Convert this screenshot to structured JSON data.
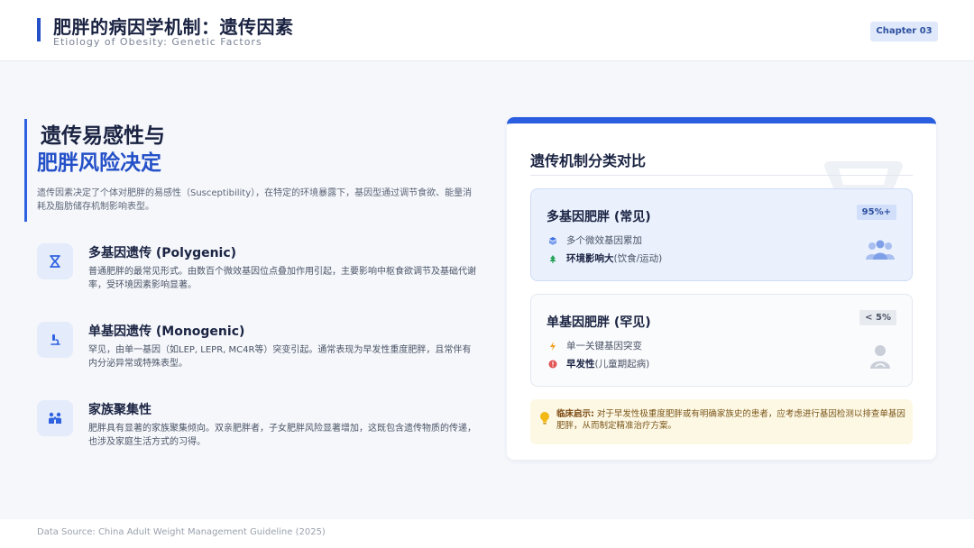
{
  "header": {
    "title": "肥胖的病因学机制：遗传因素",
    "subtitle": "Etiology of Obesity: Genetic Factors",
    "chapter": "Chapter 03"
  },
  "left": {
    "title_line1": "遗传易感性与",
    "title_line2": "肥胖风险决定",
    "intro": "遗传因素决定了个体对肥胖的易感性（Susceptibility），在特定的环境暴露下，基因型通过调节食欲、能量消耗及脂肪储存机制影响表型。",
    "features": [
      {
        "title": "多基因遗传 (Polygenic)",
        "desc": "普通肥胖的最常见形式。由数百个微效基因位点叠加作用引起，主要影响中枢食欲调节及基础代谢率，受环境因素影响显著。",
        "icon": "hourglass-dna-icon"
      },
      {
        "title": "单基因遗传 (Monogenic)",
        "desc": "罕见，由单一基因（如LEP, LEPR, MC4R等）突变引起。通常表现为早发性重度肥胖，且常伴有内分泌异常或特殊表型。",
        "icon": "microscope-icon"
      },
      {
        "title": "家族聚集性",
        "desc": "肥胖具有显著的家族聚集倾向。双亲肥胖者，子女肥胖风险显著增加，这既包含遗传物质的传递，也涉及家庭生活方式的习得。",
        "icon": "family-icon"
      }
    ]
  },
  "card": {
    "title": "遗传机制分类对比",
    "polygenic": {
      "title": "多基因肥胖 (常见)",
      "badge": "95%+",
      "line1": "多个微效基因累加",
      "line2_bold": "环境影响大",
      "line2_rest": " (饮食/运动)"
    },
    "monogenic": {
      "title": "单基因肥胖 (罕见)",
      "badge": "< 5%",
      "line1": "单一关键基因突变",
      "line2_bold": "早发性",
      "line2_rest": " (儿童期起病)"
    },
    "note": {
      "label": "临床启示:",
      "text": " 对于早发性极重度肥胖或有明确家族史的患者，应考虑进行基因检测以排查单基因肥胖，从而制定精准治疗方案。"
    }
  },
  "footer": {
    "source": "Data Source: China Adult Weight Management Guideline (2025)"
  },
  "colors": {
    "accent": "#2450c8",
    "note_bg": "#fdf8e4"
  }
}
